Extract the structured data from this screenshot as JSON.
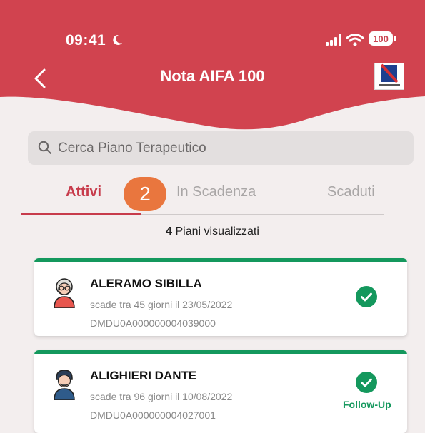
{
  "status_bar": {
    "time": "09:41",
    "battery": "100"
  },
  "nav": {
    "title": "Nota AIFA 100",
    "back_label": "<",
    "logo_text": "REGIONE CAMPANIA"
  },
  "search": {
    "placeholder": "Cerca Piano Terapeutico"
  },
  "tabs": [
    {
      "label": "Attivi",
      "active": true
    },
    {
      "label": "In Scadenza",
      "active": false
    },
    {
      "label": "Scaduti",
      "active": false
    }
  ],
  "step_badge": "2",
  "summary": {
    "count": "4",
    "text": "Piani visualizzati"
  },
  "plans": [
    {
      "name": "ALERAMO SIBILLA",
      "expiry": "scade tra 45 giorni il 23/05/2022",
      "code": "DMDU0A000000004039000",
      "avatar": "elderly-woman-avatar-icon",
      "status": "check-icon",
      "tag": ""
    },
    {
      "name": "ALIGHIERI DANTE",
      "expiry": "scade tra 96 giorni il 10/08/2022",
      "code": "DMDU0A000000004027001",
      "avatar": "man-avatar-icon",
      "status": "check-icon",
      "tag": "Follow-Up"
    }
  ],
  "colors": {
    "header": "#d1434f",
    "accent": "#c73b4b",
    "success": "#14985d",
    "badge": "#e9763e",
    "background": "#f3eeee"
  }
}
